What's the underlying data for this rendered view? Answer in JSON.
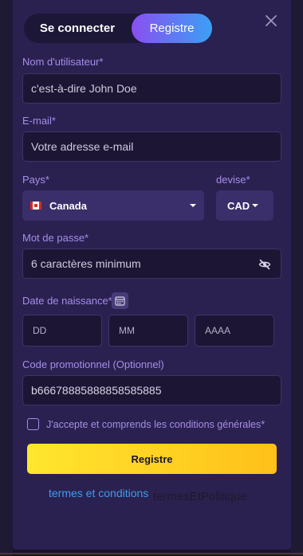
{
  "tabs": {
    "login_label": "Se connecter",
    "register_label": "Registre"
  },
  "fields": {
    "username": {
      "label": "Nom d'utilisateur*",
      "placeholder": "c'est-à-dire John Doe"
    },
    "email": {
      "label": "E-mail*",
      "placeholder": "Votre adresse e-mail"
    },
    "country": {
      "label": "Pays*",
      "value": "Canada"
    },
    "currency": {
      "label": "devise*",
      "value": "CAD"
    },
    "password": {
      "label": "Mot de passe*",
      "placeholder": "6 caractères minimum"
    },
    "birthdate": {
      "label": "Date de naissance*",
      "day_placeholder": "DD",
      "month_placeholder": "MM",
      "year_placeholder": "AAAA"
    },
    "promo": {
      "label": "Code promotionnel (Optionnel)",
      "value": "b66678885888858585885"
    }
  },
  "terms": {
    "checkbox_label": "J'accepte et comprends les conditions générales*"
  },
  "submit_label": "Registre",
  "footer": {
    "terms_link": "termes et conditions",
    "policy_link": "termesEtPolitique"
  },
  "icons": {
    "close": "close-icon",
    "eye": "eye-slash-icon",
    "calendar": "calendar-icon",
    "flag": "canada-flag-icon",
    "chevron": "chevron-down-icon"
  },
  "colors": {
    "accent_label": "#a68de8",
    "modal_bg": "#2a2150",
    "submit_from": "#ffe62e",
    "submit_to": "#ffc01a",
    "link": "#3d9dea"
  }
}
